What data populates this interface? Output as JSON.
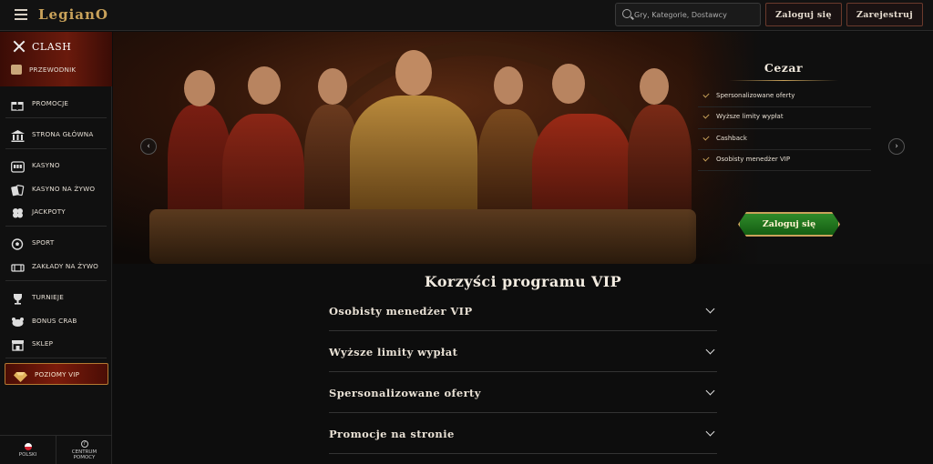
{
  "header": {
    "logo": "LegianO",
    "search_placeholder": "Gry, Kategorie, Dostawcy",
    "login_label": "Zaloguj się",
    "register_label": "Zarejestruj"
  },
  "sidebar": {
    "clash_title": "CLASH",
    "guide_label": "PRZEWODNIK",
    "items": [
      {
        "label": "PROMOCJE",
        "icon": "gift-icon"
      },
      {
        "label": "STRONA GŁÓWNA",
        "icon": "home-icon"
      },
      {
        "label": "KASYNO",
        "icon": "slot-machine-icon"
      },
      {
        "label": "KASYNO NA ŻYWO",
        "icon": "cards-icon"
      },
      {
        "label": "JACKPOTY",
        "icon": "clover-icon"
      },
      {
        "label": "SPORT",
        "icon": "ball-icon"
      },
      {
        "label": "ZAKŁADY NA ŻYWO",
        "icon": "live-bet-icon"
      },
      {
        "label": "TURNIEJE",
        "icon": "trophy-icon"
      },
      {
        "label": "BONUS CRAB",
        "icon": "crab-icon"
      },
      {
        "label": "SKLEP",
        "icon": "shop-icon"
      },
      {
        "label": "POZIOMY VIP",
        "icon": "diamond-icon"
      }
    ],
    "language": "POLSKI",
    "help": "CENTRUM POMOCY"
  },
  "banner": {
    "card_title": "Cezar",
    "features": [
      "Spersonalizowane oferty",
      "Wyższe limity wypłat",
      "Cashback",
      "Osobisty menedżer VIP"
    ],
    "cta_label": "Zaloguj się"
  },
  "vip": {
    "heading": "Korzyści programu VIP",
    "accordion": [
      "Osobisty menedżer VIP",
      "Wyższe limity wypłat",
      "Spersonalizowane oferty",
      "Promocje na stronie"
    ]
  },
  "colors": {
    "accent_gold": "#c9a25a",
    "cta_green": "#2f8a2a",
    "vip_red": "#7b1b0b"
  }
}
